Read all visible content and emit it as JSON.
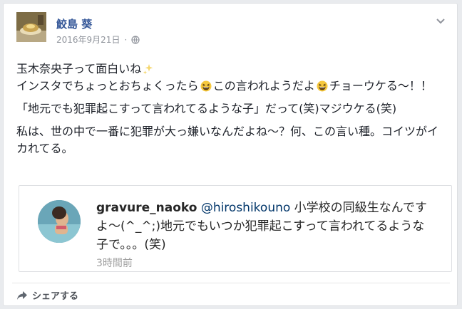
{
  "post": {
    "author": "鮫島 葵",
    "date": "2016年9月21日",
    "privacy_icon": "globe-icon",
    "menu_icon": "chevron-down-icon",
    "lines": [
      "玉木奈央子って面白いね",
      "インスタでちょっとおちょくったら",
      "この言われようだよ",
      "チョーウケる〜！！",
      "「地元でも犯罪起こすって言われてるような子」だって(笑)マジウケる(笑)",
      "私は、世の中で一番に犯罪が大っ嫌いなんだよね〜？何、この言い種。コイツがイカれてる。"
    ],
    "emojis": [
      "sparkles-icon",
      "grinning-squint-face-icon",
      "grinning-squint-face-icon"
    ]
  },
  "embed": {
    "username": "gravure_naoko",
    "mention": "@hiroshikouno",
    "text": " 小学校の同級生なんですよ〜(^_^;)地元でもいつか犯罪起こすって言われてるような子で。。。(笑)",
    "time": "3時間前"
  },
  "actions": {
    "share_label": "シェアする",
    "share_icon": "share-arrow-icon"
  },
  "colors": {
    "link": "#365899",
    "meta": "#90949c",
    "background": "#e9ebee"
  }
}
